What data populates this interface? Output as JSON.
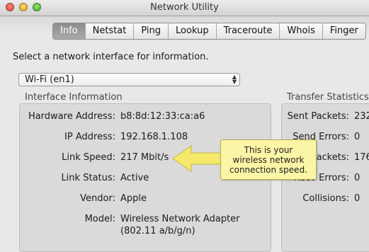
{
  "window": {
    "title": "Network Utility"
  },
  "tabs": [
    {
      "label": "Info",
      "active": true
    },
    {
      "label": "Netstat",
      "active": false
    },
    {
      "label": "Ping",
      "active": false
    },
    {
      "label": "Lookup",
      "active": false
    },
    {
      "label": "Traceroute",
      "active": false
    },
    {
      "label": "Whois",
      "active": false
    },
    {
      "label": "Finger",
      "active": false
    }
  ],
  "prompt": "Select a network interface for information.",
  "interface_select": {
    "value": "Wi-Fi (en1)"
  },
  "interface_info": {
    "heading": "Interface Information",
    "rows": [
      {
        "label": "Hardware Address:",
        "value": "b8:8d:12:33:ca:a6"
      },
      {
        "label": "IP Address:",
        "value": "192.168.1.108"
      },
      {
        "label": "Link Speed:",
        "value": "217 Mbit/s"
      },
      {
        "label": "Link Status:",
        "value": "Active"
      },
      {
        "label": "Vendor:",
        "value": "Apple"
      },
      {
        "label": "Model:",
        "value": "Wireless Network Adapter",
        "value2": "(802.11 a/b/g/n)"
      }
    ]
  },
  "transfer_stats": {
    "heading": "Transfer Statistics",
    "rows": [
      {
        "label": "Sent Packets:",
        "value": "232"
      },
      {
        "label": "Send Errors:",
        "value": "0"
      },
      {
        "label": "Recv Packets:",
        "value": "176"
      },
      {
        "label": "Recv Errors:",
        "value": "0"
      },
      {
        "label": "Collisions:",
        "value": "0"
      }
    ]
  },
  "callout": {
    "line1": "This is your",
    "line2": "wireless network",
    "line3": "connection speed."
  },
  "colors": {
    "callout_fill": "#fbf5a6",
    "callout_arrow": "#f4e96a",
    "active_tab": "#9a9a9a"
  }
}
